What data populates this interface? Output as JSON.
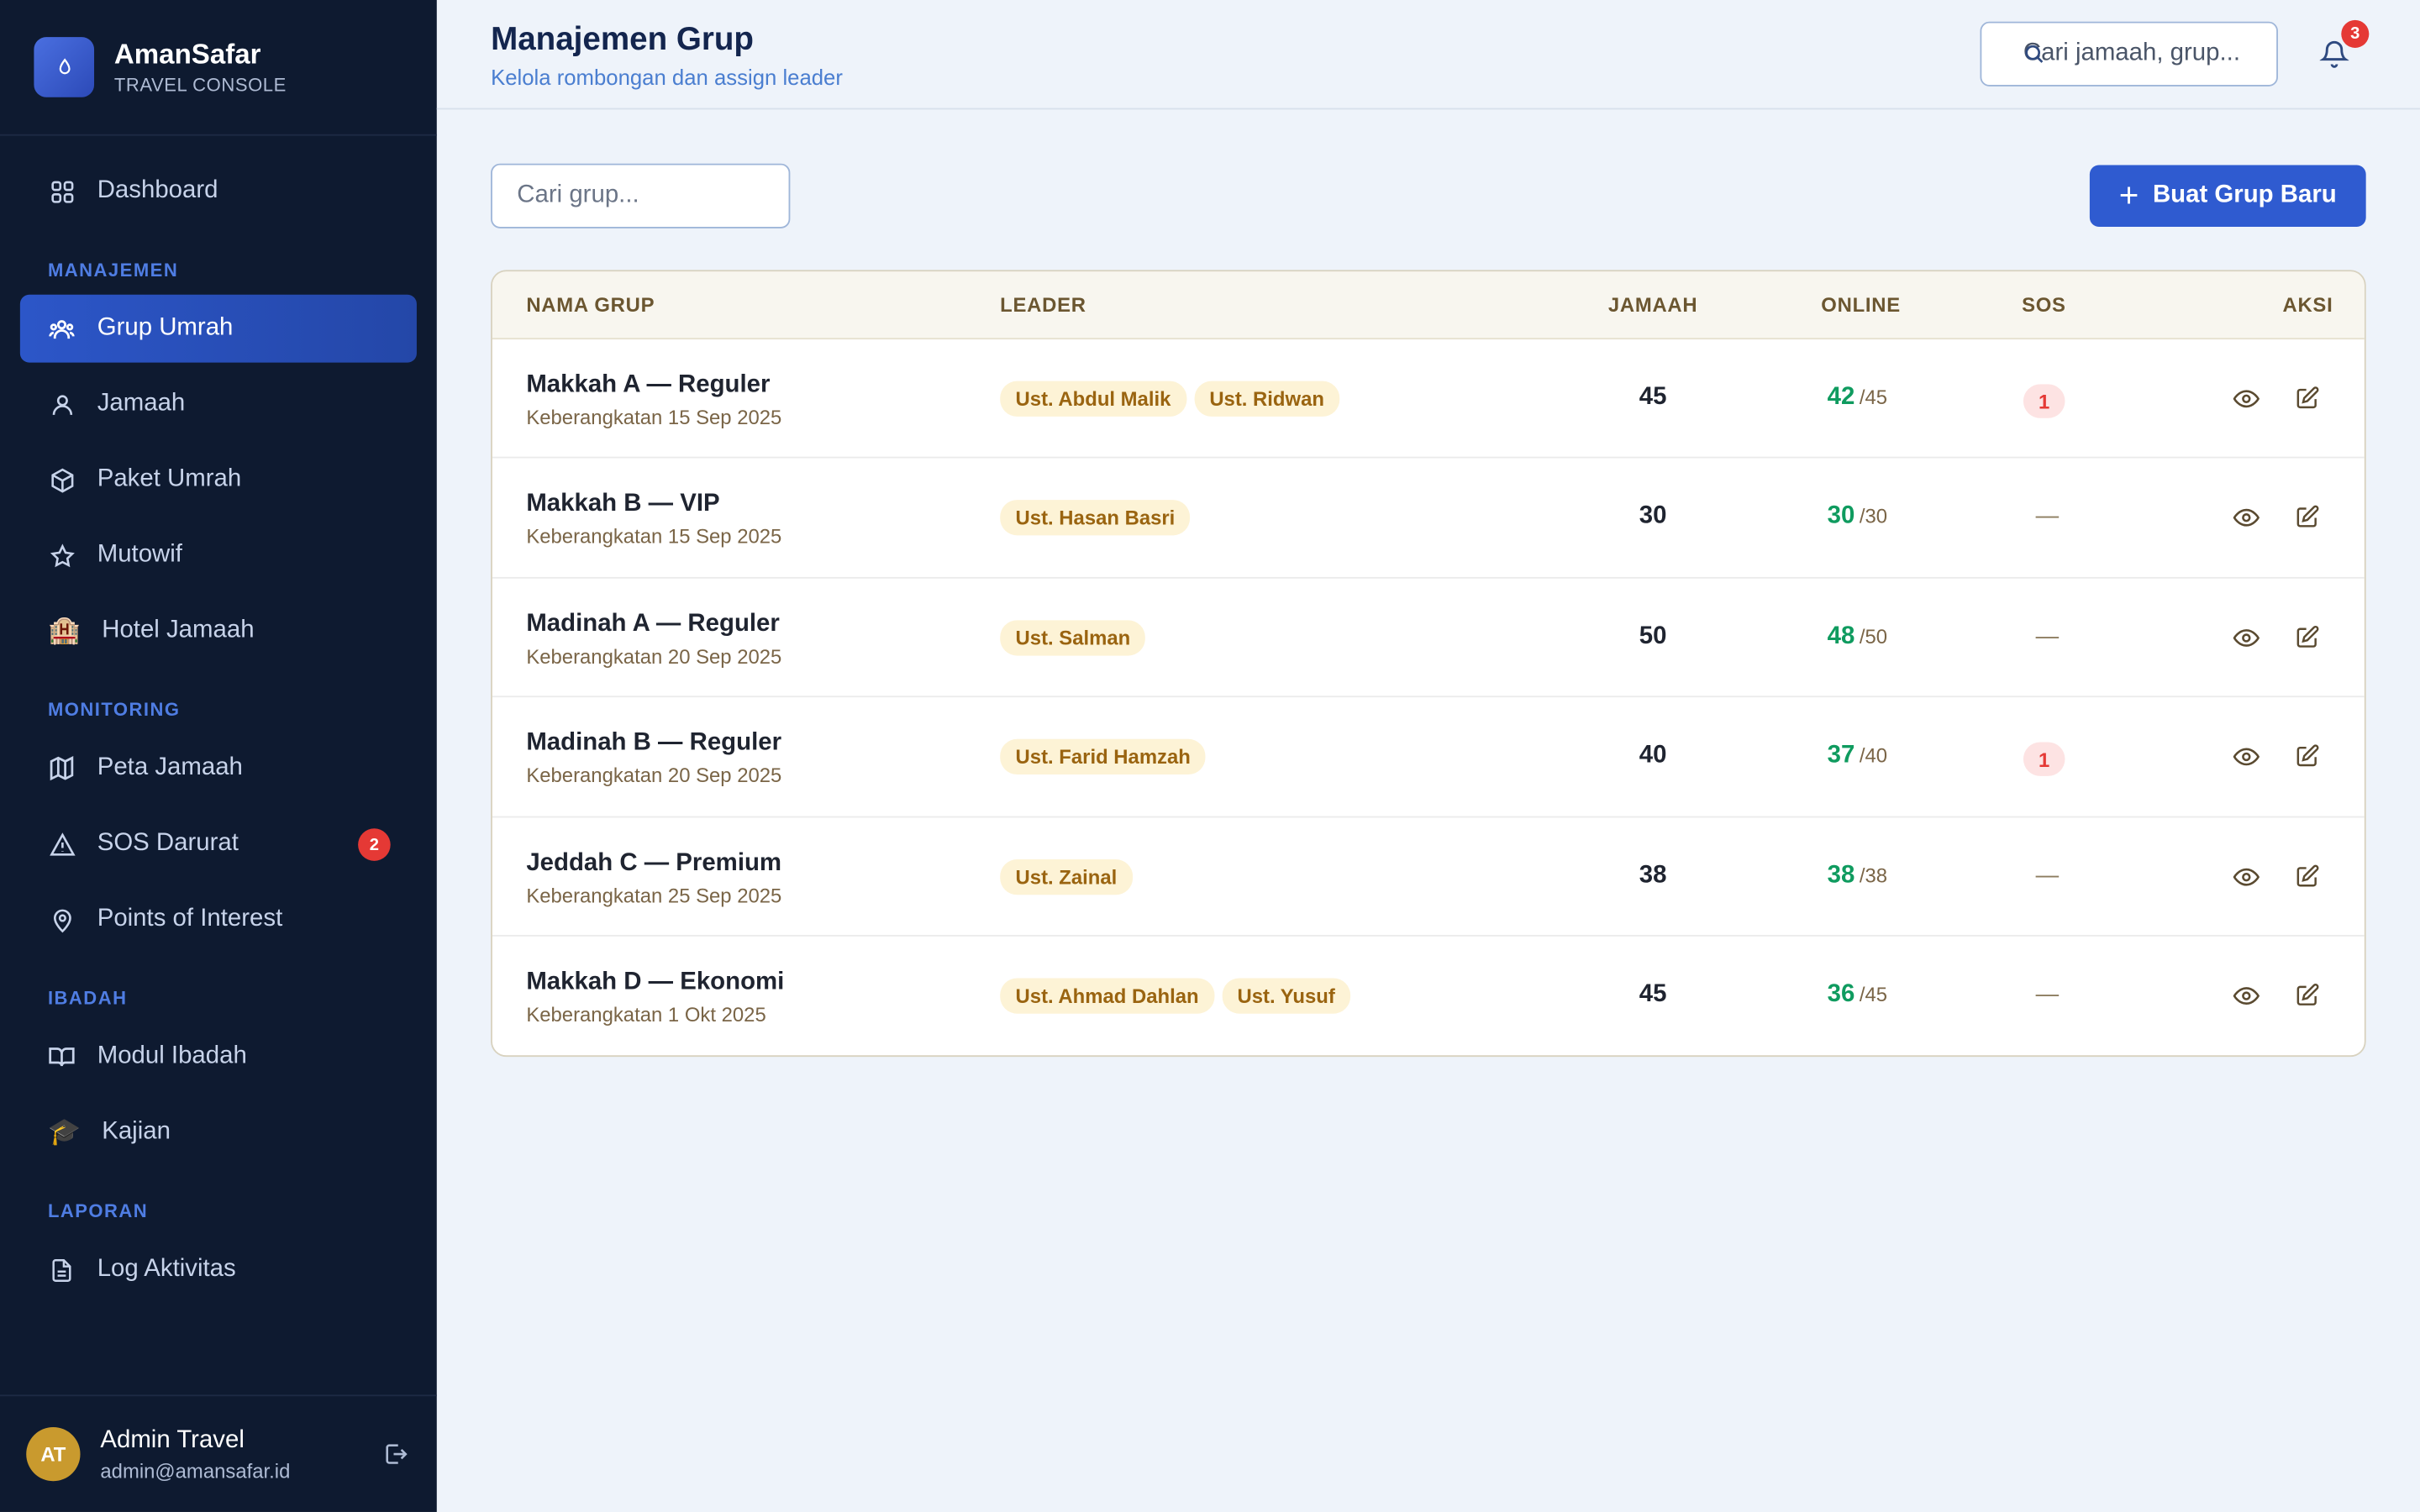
{
  "brand": {
    "title": "AmanSafar",
    "subtitle": "TRAVEL CONSOLE"
  },
  "sidebar": {
    "dashboard": "Dashboard",
    "sections": {
      "manajemen": "MANAJEMEN",
      "monitoring": "MONITORING",
      "ibadah": "IBADAH",
      "laporan": "LAPORAN"
    },
    "items": {
      "grup_umrah": "Grup Umrah",
      "jamaah": "Jamaah",
      "paket_umrah": "Paket Umrah",
      "mutowif": "Mutowif",
      "hotel_jamaah": "Hotel Jamaah",
      "peta_jamaah": "Peta Jamaah",
      "sos_darurat": "SOS Darurat",
      "sos_badge": "2",
      "points_of_interest": "Points of Interest",
      "modul_ibadah": "Modul Ibadah",
      "kajian": "Kajian",
      "log_aktivitas": "Log Aktivitas"
    },
    "emoji": {
      "hotel": "🏨",
      "kajian": "🎓"
    },
    "user": {
      "initials": "AT",
      "name": "Admin Travel",
      "email": "admin@amansafar.id"
    }
  },
  "header": {
    "title": "Manajemen Grup",
    "subtitle": "Kelola rombongan dan assign leader",
    "search_placeholder": "Cari jamaah, grup...",
    "notification_count": "3"
  },
  "toolbar": {
    "search_placeholder": "Cari grup...",
    "create_button": "Buat Grup Baru"
  },
  "table": {
    "columns": {
      "nama_grup": "NAMA GRUP",
      "leader": "LEADER",
      "jamaah": "JAMAAH",
      "online": "ONLINE",
      "sos": "SOS",
      "aksi": "AKSI"
    },
    "rows": [
      {
        "name": "Makkah A — Reguler",
        "date": "Keberangkatan 15 Sep 2025",
        "leaders": [
          "Ust. Abdul Malik",
          "Ust. Ridwan"
        ],
        "jamaah": "45",
        "online": "42",
        "online_total": "/45",
        "sos": "1"
      },
      {
        "name": "Makkah B — VIP",
        "date": "Keberangkatan 15 Sep 2025",
        "leaders": [
          "Ust. Hasan Basri"
        ],
        "jamaah": "30",
        "online": "30",
        "online_total": "/30",
        "sos": "—"
      },
      {
        "name": "Madinah A — Reguler",
        "date": "Keberangkatan 20 Sep 2025",
        "leaders": [
          "Ust. Salman"
        ],
        "jamaah": "50",
        "online": "48",
        "online_total": "/50",
        "sos": "—"
      },
      {
        "name": "Madinah B — Reguler",
        "date": "Keberangkatan 20 Sep 2025",
        "leaders": [
          "Ust. Farid Hamzah"
        ],
        "jamaah": "40",
        "online": "37",
        "online_total": "/40",
        "sos": "1"
      },
      {
        "name": "Jeddah C — Premium",
        "date": "Keberangkatan 25 Sep 2025",
        "leaders": [
          "Ust. Zainal"
        ],
        "jamaah": "38",
        "online": "38",
        "online_total": "/38",
        "sos": "—"
      },
      {
        "name": "Makkah D — Ekonomi",
        "date": "Keberangkatan 1 Okt 2025",
        "leaders": [
          "Ust. Ahmad Dahlan",
          "Ust. Yusuf"
        ],
        "jamaah": "45",
        "online": "36",
        "online_total": "/45",
        "sos": "—"
      }
    ]
  },
  "colors": {
    "sidebar_bg": "#0e1a30",
    "accent": "#2f5bd0",
    "online_green": "#0f9b5f",
    "sos_red": "#e53935",
    "chip_bg": "#fdf3d6",
    "chip_text": "#9a6410"
  }
}
